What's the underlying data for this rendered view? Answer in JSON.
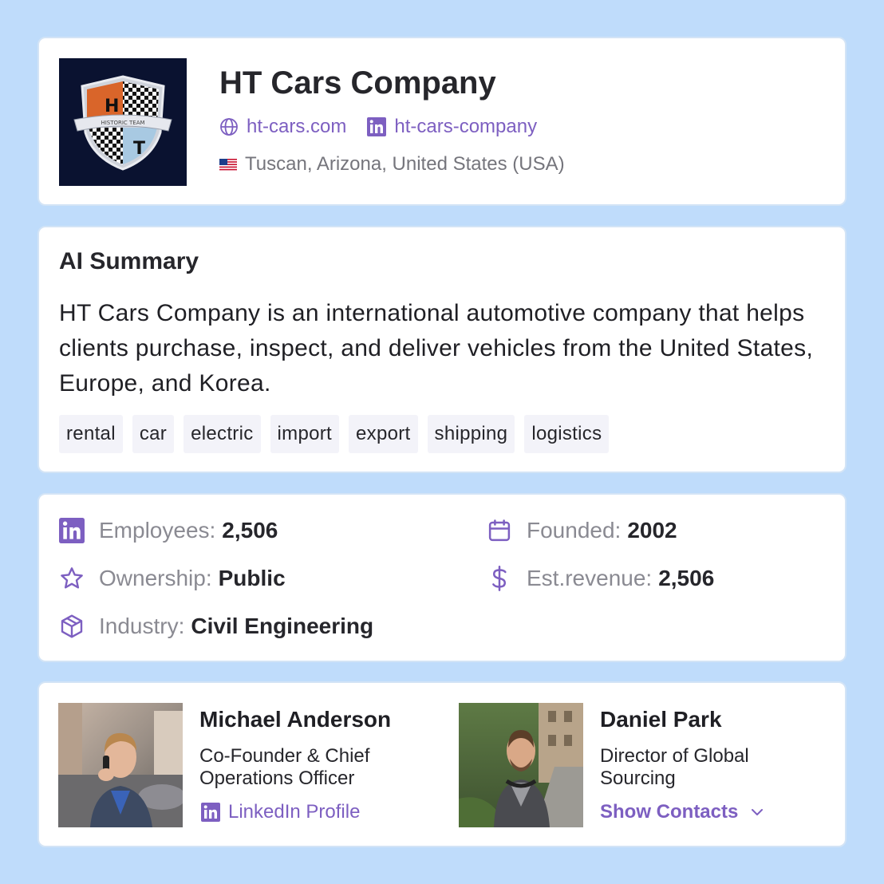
{
  "company": {
    "name": "HT Cars Company",
    "logo_text": "HISTORIC TEAM",
    "website": "ht-cars.com",
    "linkedin": "ht-cars-company",
    "location": "Tuscan, Arizona, United States (USA)"
  },
  "summary": {
    "title": "AI Summary",
    "text": "HT Cars Company is an international automotive company that helps clients purchase, inspect, and deliver vehicles from the United States, Europe, and Korea.",
    "tags": [
      "rental",
      "car",
      "electric",
      "import",
      "export",
      "shipping",
      "logistics"
    ]
  },
  "stats": {
    "employees": {
      "label": "Employees:",
      "value": "2,506",
      "icon": "linkedin-icon"
    },
    "founded": {
      "label": "Founded:",
      "value": "2002",
      "icon": "calendar-icon"
    },
    "ownership": {
      "label": "Ownership:",
      "value": "Public",
      "icon": "star-icon"
    },
    "revenue": {
      "label": "Est.revenue:",
      "value": "2,506",
      "icon": "dollar-icon"
    },
    "industry": {
      "label": "Industry:",
      "value": "Civil Engineering",
      "icon": "box-icon"
    }
  },
  "contacts": [
    {
      "name": "Michael Anderson",
      "role": "Co-Founder & Chief Operations Officer",
      "action": "LinkedIn Profile"
    },
    {
      "name": "Daniel Park",
      "role": "Director of Global Sourcing",
      "action": "Show Contacts"
    }
  ],
  "colors": {
    "background": "#bfdcfb",
    "accent": "#7d5fc1",
    "tag_bg": "#f3f3f9"
  }
}
